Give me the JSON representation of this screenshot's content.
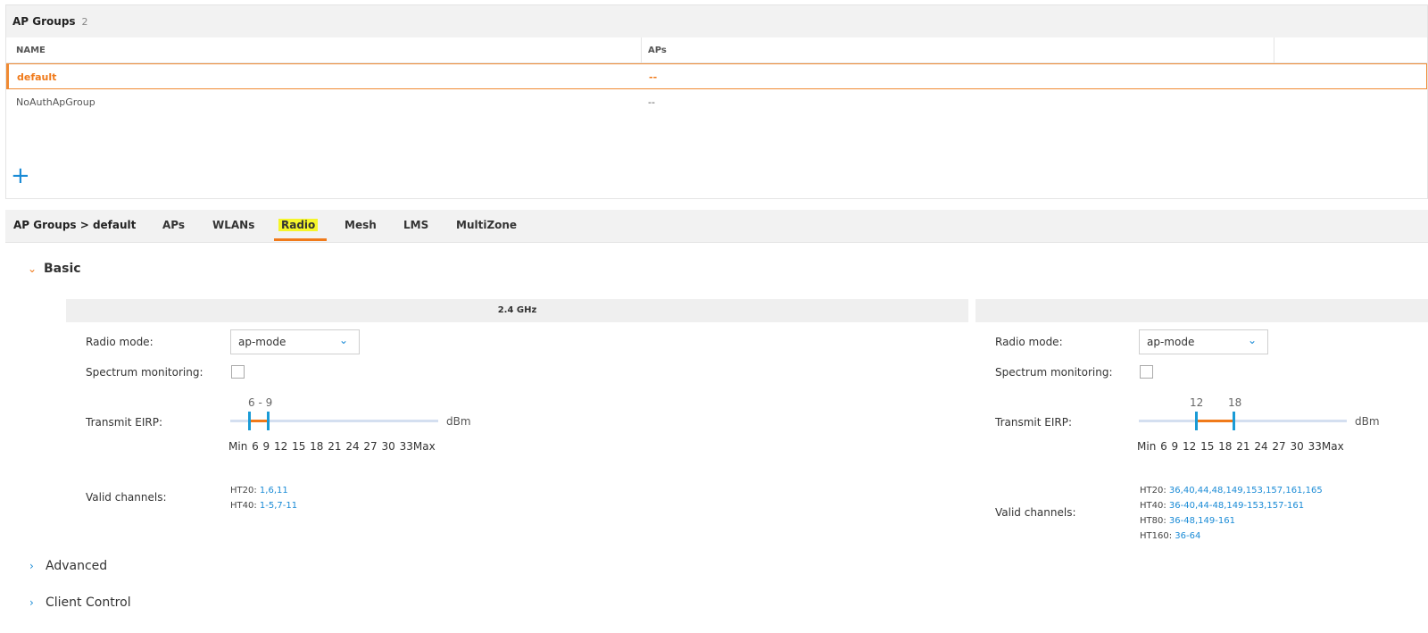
{
  "groups": {
    "title": "AP Groups",
    "count": "2",
    "columns": [
      "NAME",
      "APs"
    ],
    "rows": [
      {
        "name": "default",
        "aps": "--"
      },
      {
        "name": "NoAuthApGroup",
        "aps": "--"
      }
    ],
    "add_icon": "+"
  },
  "detail": {
    "breadcrumb": "AP Groups > default",
    "tabs": [
      "APs",
      "WLANs",
      "Radio",
      "Mesh",
      "LMS",
      "MultiZone"
    ],
    "active_tab": "Radio"
  },
  "sections": {
    "basic": "Basic",
    "advanced": "Advanced",
    "client_control": "Client Control"
  },
  "bands": [
    {
      "header": "2.4 GHz",
      "radio_mode_label": "Radio mode:",
      "radio_mode_value": "ap-mode",
      "spectrum_label": "Spectrum monitoring:",
      "spectrum_checked": false,
      "eirp_label": "Transmit EIRP:",
      "eirp_value": "6 - 9",
      "eirp_min": 6,
      "eirp_max": 9,
      "eirp_unit": "dBm",
      "eirp_ticks": "Min 6 9 12 15 18 21 24 27 30 33Max",
      "channels_label": "Valid channels:",
      "channels": [
        {
          "prefix": "HT20:",
          "value": "1,6,11"
        },
        {
          "prefix": "HT40:",
          "value": "1-5,7-11"
        }
      ]
    },
    {
      "header": "",
      "radio_mode_label": "Radio mode:",
      "radio_mode_value": "ap-mode",
      "spectrum_label": "Spectrum monitoring:",
      "spectrum_checked": false,
      "eirp_label": "Transmit EIRP:",
      "eirp_low_label": "12",
      "eirp_high_label": "18",
      "eirp_min": 12,
      "eirp_max": 18,
      "eirp_unit": "dBm",
      "eirp_ticks": "Min 6 9 12 15 18 21 24 27 30 33Max",
      "channels_label": "Valid channels:",
      "channels": [
        {
          "prefix": "HT20:",
          "value": "36,40,44,48,149,153,157,161,165"
        },
        {
          "prefix": "HT40:",
          "value": "36-40,44-48,149-153,157-161"
        },
        {
          "prefix": "HT80:",
          "value": "36-48,149-161"
        },
        {
          "prefix": "HT160:",
          "value": "36-64"
        }
      ]
    }
  ],
  "icons": {
    "chevron_open": "chevron-down-icon",
    "chevron_closed": "chevron-right-icon",
    "select_arrow": "chevron-down-icon"
  },
  "colors": {
    "accent": "#f07a1a",
    "link": "#1a8bd6",
    "handle": "#1a9bd6",
    "highlight": "#f5f52a"
  }
}
